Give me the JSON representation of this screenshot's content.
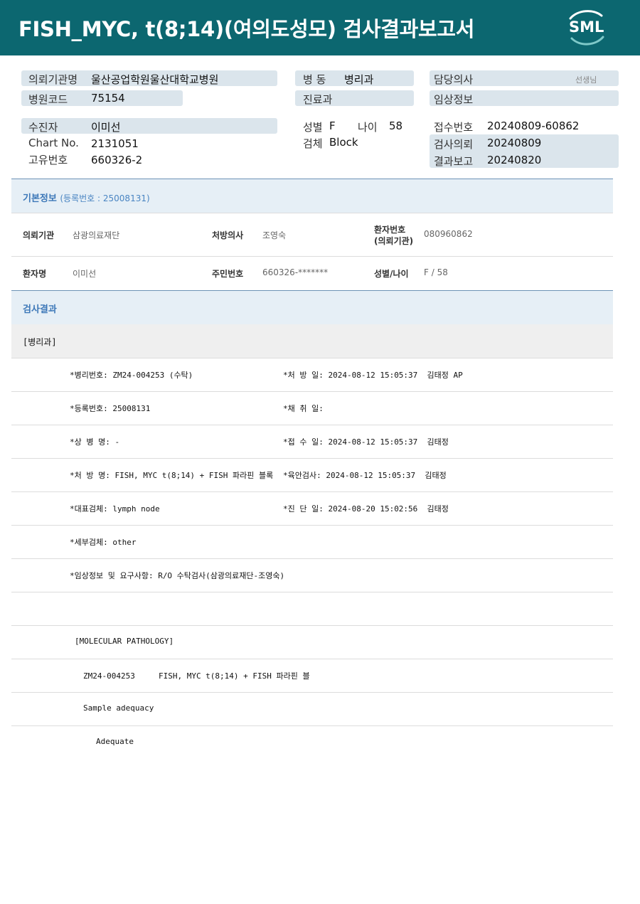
{
  "header": {
    "title": "FISH_MYC,  t(8;14)(여의도성모) 검사결과보고서",
    "logo_text": "SML"
  },
  "top": {
    "referring_org_label": "의뢰기관명",
    "referring_org": "울산공업학원울산대학교병원",
    "hospital_code_label": "병원코드",
    "hospital_code": "75154",
    "ward_label": "병  동",
    "ward": "병리과",
    "dept_label": "진료과",
    "doctor_label": "담당의사",
    "doctor_suffix": "선생님",
    "clinical_info_label": "임상정보",
    "patient_label": "수진자",
    "patient": "이미선",
    "chart_label": "Chart No.",
    "chart_no": "2131051",
    "unique_label": "고유번호",
    "unique_no": "660326-2",
    "sex_label": "성별",
    "sex": "F",
    "age_label": "나이",
    "age": "58",
    "specimen_label": "검체",
    "specimen": "Block",
    "receipt_label": "접수번호",
    "receipt_no": "20240809-60862",
    "request_label": "검사의뢰",
    "request_date": "20240809",
    "report_label": "결과보고",
    "report_date": "20240820"
  },
  "basic_info": {
    "title": "기본정보",
    "subtitle": "(등록번호 : 25008131)",
    "org_label": "의뢰기관",
    "org": "삼광의료재단",
    "prescriber_label": "처방의사",
    "prescriber": "조영숙",
    "pid_label_1": "환자번호",
    "pid_label_2": "(의뢰기관)",
    "pid": "080960862",
    "name_label": "환자명",
    "name": "이미선",
    "rrn_label": "주민번호",
    "rrn": "660326-*******",
    "sexage_label": "성별/나이",
    "sexage": "F / 58"
  },
  "results": {
    "title": "검사결과",
    "category": "[병리과]",
    "rows": [
      {
        "left": "*병리번호: ZM24-004253 (수탁)",
        "right": "*처 방 일: 2024-08-12 15:05:37  김태정 AP"
      },
      {
        "left": "*등록번호: 25008131",
        "right": "*채 취 일:"
      },
      {
        "left": "*상 병 명: -",
        "right": "*접 수 일: 2024-08-12 15:05:37  김태정"
      },
      {
        "left": "*처 방 명: FISH, MYC t(8;14) + FISH 파라핀 블록",
        "right": "*육안검사: 2024-08-12 15:05:37  김태정"
      },
      {
        "left": "*대표검체: lymph node",
        "right": "*진 단 일: 2024-08-20 15:02:56  김태정"
      },
      {
        "left": "*세부검체: other",
        "right": ""
      },
      {
        "left": "*임상정보 및 요구사항: R/O 수탁검사(삼광의료재단-조영숙)",
        "right": ""
      }
    ],
    "molecular": {
      "heading": "[MOLECULAR PATHOLOGY]",
      "line1": "ZM24-004253     FISH, MYC t(8;14) + FISH 파라핀 블",
      "line2": "Sample adequacy",
      "line3": "Adequate"
    }
  }
}
